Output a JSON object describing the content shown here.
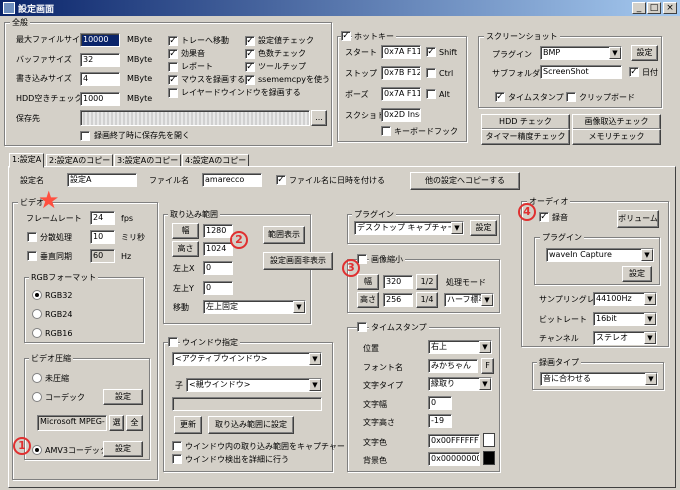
{
  "window": {
    "title": "設定画面",
    "minimize": "_",
    "maximize": "□",
    "close": "×"
  },
  "general": {
    "group": "全般",
    "max_file_size": {
      "label": "最大ファイルサイズ",
      "value": "10000",
      "unit": "MByte"
    },
    "buffer_size": {
      "label": "バッファサイズ",
      "value": "32",
      "unit": "MByte"
    },
    "write_size": {
      "label": "書き込みサイズ",
      "value": "4",
      "unit": "MByte"
    },
    "hdd_free": {
      "label": "HDD空きチェック",
      "value": "1000",
      "unit": "MByte"
    },
    "save_dir": {
      "label": "保存先",
      "browse": "..."
    },
    "open_after": "録画終了時に保存先を開く"
  },
  "options": {
    "tray": "トレーへ移動",
    "sound": "効果音",
    "report": "レポート",
    "mouse": "マウスを録画する",
    "layer": "レイヤードウインドウを録画する",
    "settings_check": "設定値チェック",
    "color_check": "色数チェック",
    "tooltip": "ツールチップ",
    "sse": "ssememcpyを使う"
  },
  "hotkey": {
    "group": "ホットキー",
    "start": {
      "label": "スタート",
      "value": "0x7A F11",
      "mod": "Shift"
    },
    "stop": {
      "label": "ストップ",
      "value": "0x7B F12",
      "mod": "Ctrl"
    },
    "pause": {
      "label": "ポーズ",
      "value": "0x7A F11",
      "mod": "Alt"
    },
    "snapshot": {
      "label": "スクショト",
      "value": "0x2D Inse"
    },
    "keyboard_hook": "キーボードフック"
  },
  "screenshot": {
    "group": "スクリーンショット",
    "plugin_label": "プラグイン",
    "plugin": "BMP",
    "settings": "設定",
    "subfolder_label": "サブフォルダ",
    "subfolder": "ScreenShot",
    "date": "日付",
    "timestamp": "タイムスタンプ",
    "clipboard": "クリップボード"
  },
  "buttons": {
    "hdd_check": "HDD チェック",
    "capture_check": "画像取込チェック",
    "timer_check": "タイマー精度チェック",
    "memory_check": "メモリチェック"
  },
  "tabs": [
    "1:設定A",
    "2:設定Aのコピー",
    "3:設定Aのコピー",
    "4:設定Aのコピー"
  ],
  "profile": {
    "name_label": "設定名",
    "name": "設定A",
    "file_label": "ファイル名",
    "file": "amarecco",
    "append_date": "ファイル名に日時を付ける",
    "copy_button": "他の設定へコピーする"
  },
  "video": {
    "group": "ビデオ",
    "framerate_label": "フレームレート",
    "framerate": "24",
    "fps": "fps",
    "split_label": "分散処理",
    "split": "10",
    "ms": "ミリ秒",
    "vsync_label": "垂直同期",
    "vsync": "60",
    "hz": "Hz",
    "rgb_group": "RGBフォーマット",
    "rgb32": "RGB32",
    "rgb24": "RGB24",
    "rgb16": "RGB16",
    "comp_group": "ビデオ圧縮",
    "uncompressed": "未圧縮",
    "codec": "コーデック",
    "codec_settings": "設定",
    "codec_name": "Microsoft MPEG-",
    "select": "選",
    "all": "全",
    "amv3": "AMV3コーデック",
    "amv3_settings": "設定"
  },
  "capture": {
    "group": "取り込み範囲",
    "width_btn": "幅",
    "width": "1280",
    "height_btn": "高さ",
    "height": "1024",
    "lr_label": "左上X",
    "lr": "0",
    "ud_label": "左上Y",
    "ud": "0",
    "move_label": "移動",
    "move": "左上固定",
    "show_range": "範囲表示",
    "hide_settings": "設定画面非表示"
  },
  "window_spec": {
    "group": "ウインドウ指定",
    "active": "<アクティブウインドウ>",
    "child_label": "子",
    "parent": "<親ウインドウ>",
    "refresh": "更新",
    "set_range": "取り込み範囲に設定",
    "capture_inside": "ウインドウ内の取り込み範囲をキャプチャー",
    "detail": "ウインドウ検出を詳細に行う"
  },
  "plugin": {
    "group": "プラグイン",
    "value": "デスクトップ キャプチャー",
    "settings": "設定"
  },
  "shrink": {
    "group": "画像縮小",
    "width_btn": "幅",
    "width": "320",
    "half": "1/2",
    "mode_label": "処理モード",
    "height_btn": "高さ",
    "height": "256",
    "quarter": "1/4",
    "mode": "ハーフ標準"
  },
  "timestamp": {
    "group": "タイムスタンプ",
    "pos_label": "位置",
    "pos": "右上",
    "font_label": "フォント名",
    "font": "みかちゃん",
    "font_btn": "F",
    "type_label": "文字タイプ",
    "type": "縁取り",
    "cw_label": "文字幅",
    "cw": "0",
    "ch_label": "文字高さ",
    "ch": "-19",
    "color_label": "文字色",
    "color": "0x00FFFFFF",
    "bg_label": "背景色",
    "bg": "0x00000000",
    "text_color": "#ffffff",
    "bg_color": "#000000"
  },
  "audio": {
    "group": "オーディオ",
    "record": "録音",
    "volume": "ボリューム",
    "plugin_group": "プラグイン",
    "plugin": "waveIn Capture",
    "plugin_settings": "設定",
    "rate_label": "サンプリングレート",
    "rate": "44100Hz",
    "bit_label": "ビットレート",
    "bit": "16bit",
    "ch_label": "チャンネル",
    "ch": "ステレオ"
  },
  "rec_type": {
    "group": "録画タイプ",
    "value": "音に合わせる"
  },
  "annotations": {
    "one": "1",
    "two": "2",
    "three": "3",
    "four": "4",
    "star": "★",
    "color": "#e03030"
  }
}
